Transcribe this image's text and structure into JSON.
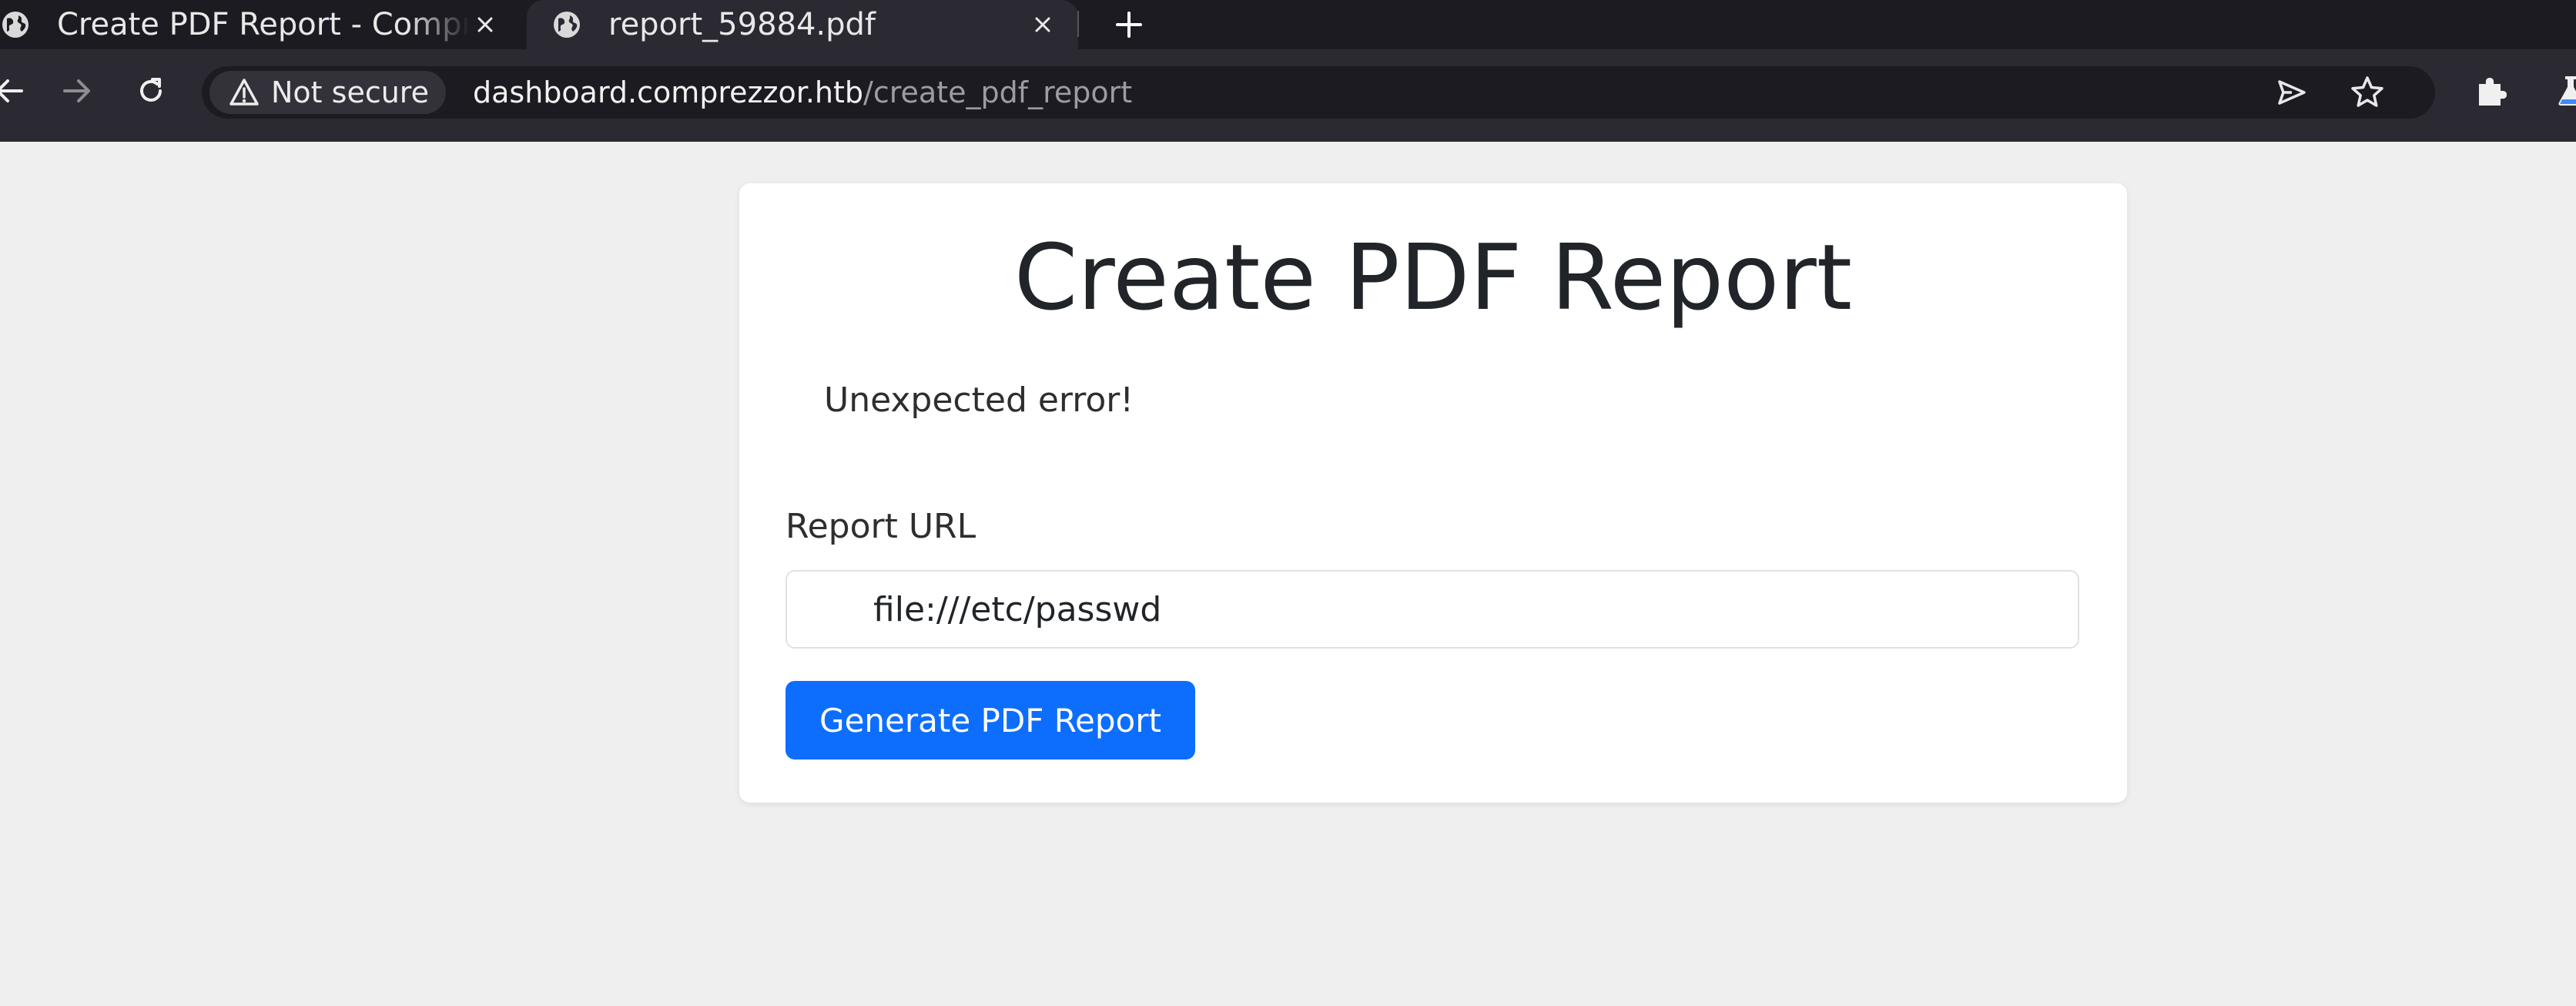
{
  "browser": {
    "tabs": [
      {
        "title": "Create PDF Report - Comprezzor",
        "icon": "globe-icon",
        "active": false
      },
      {
        "title": "report_59884.pdf",
        "icon": "globe-icon",
        "active": true
      }
    ],
    "new_tab_icon": "plus-icon",
    "security_label": "Not secure",
    "url_host": "dashboard.comprezzor.htb",
    "url_path": "/create_pdf_report",
    "colors": {
      "tabstrip": "#1c1b22",
      "toolbar": "#2b2a33",
      "urlbar": "#1c1b22"
    }
  },
  "page": {
    "title": "Create PDF Report",
    "alert": "Unexpected error!",
    "form": {
      "url_label": "Report URL",
      "url_value": "file:///etc/passwd",
      "submit_label": "Generate PDF Report"
    },
    "colors": {
      "background": "#efefef",
      "card": "#ffffff",
      "primary": "#0d6efd"
    }
  }
}
